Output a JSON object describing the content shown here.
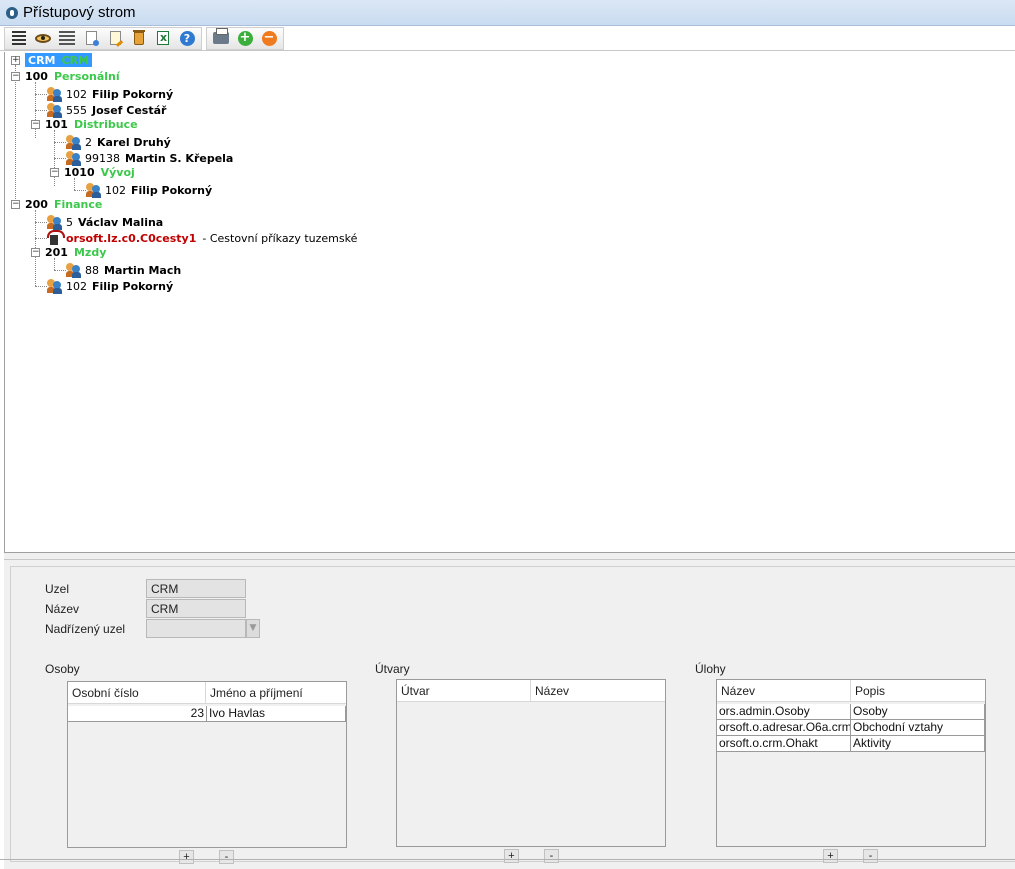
{
  "window": {
    "title": "Přístupový strom"
  },
  "toolbar": {
    "group1": [
      {
        "name": "list-icon",
        "kind": "lines"
      },
      {
        "name": "view-icon",
        "kind": "eye"
      },
      {
        "name": "view-list-icon",
        "kind": "eyelist"
      },
      {
        "name": "new-document-icon",
        "kind": "page"
      },
      {
        "name": "edit-document-icon",
        "kind": "page-edit"
      },
      {
        "name": "delete-icon",
        "kind": "bin"
      },
      {
        "name": "export-excel-icon",
        "kind": "excel"
      },
      {
        "name": "help-icon",
        "kind": "help",
        "glyph": "?"
      }
    ],
    "group2": [
      {
        "name": "print-icon",
        "kind": "print"
      },
      {
        "name": "add-icon",
        "kind": "plus",
        "glyph": "+"
      },
      {
        "name": "remove-icon",
        "kind": "minus",
        "glyph": "−"
      }
    ]
  },
  "tree": {
    "root": {
      "code": "CRM",
      "label": "CRM"
    },
    "n100": {
      "code": "100",
      "label": "Personální"
    },
    "n100_p1": {
      "num": "102",
      "name": "Filip Pokorný"
    },
    "n100_p2": {
      "num": "555",
      "name": "Josef Cestář"
    },
    "n101": {
      "code": "101",
      "label": "Distribuce"
    },
    "n101_p1": {
      "num": "2",
      "name": "Karel Druhý"
    },
    "n101_p2": {
      "num": "99138",
      "name": "Martin S. Křepela"
    },
    "n1010": {
      "code": "1010",
      "label": "Vývoj"
    },
    "n1010_p1": {
      "num": "102",
      "name": "Filip Pokorný"
    },
    "n200": {
      "code": "200",
      "label": "Finance"
    },
    "n200_p1": {
      "num": "5",
      "name": "Václav Malina"
    },
    "n200_task": {
      "code": "orsoft.lz.c0.C0cesty1",
      "desc": "- Cestovní příkazy tuzemské"
    },
    "n201": {
      "code": "201",
      "label": "Mzdy"
    },
    "n201_p1": {
      "num": "88",
      "name": "Martin Mach"
    },
    "n200_p2": {
      "num": "102",
      "name": "Filip Pokorný"
    }
  },
  "detail": {
    "uzel_label": "Uzel",
    "uzel_value": "CRM",
    "nazev_label": "Název",
    "nazev_value": "CRM",
    "nadrizeny_label": "Nadřízený uzel",
    "nadrizeny_value": "",
    "combo_glyph": "▼"
  },
  "osoby": {
    "title": "Osoby",
    "columns": [
      "Osobní číslo",
      "Jméno a příjmení"
    ],
    "rows": [
      {
        "num": "23",
        "name": "Ivo Havlas"
      }
    ],
    "add": "+",
    "remove": "-"
  },
  "utvary": {
    "title": "Útvary",
    "columns": [
      "Útvar",
      "Název"
    ],
    "add": "+",
    "remove": "-"
  },
  "ulohy": {
    "title": "Úlohy",
    "columns": [
      "Název",
      "Popis"
    ],
    "rows": [
      {
        "name": "ors.admin.Osoby",
        "desc": "Osoby"
      },
      {
        "name": "orsoft.o.adresar.O6a.crm",
        "desc": "Obchodní vztahy"
      },
      {
        "name": "orsoft.o.crm.Ohakt",
        "desc": "Aktivity"
      }
    ],
    "add": "+",
    "remove": "-"
  }
}
